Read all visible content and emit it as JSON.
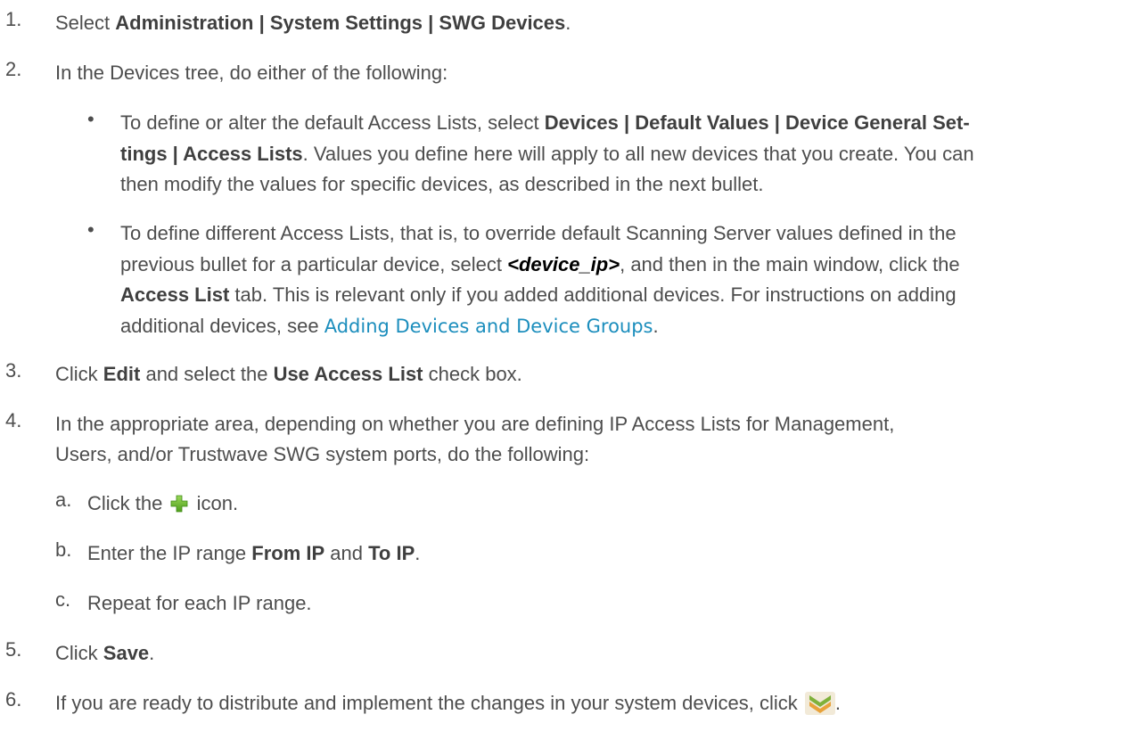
{
  "steps": [
    {
      "num": "1.",
      "pre": "Select ",
      "bold": "Administration | System Settings | SWG Devices",
      "post": "."
    },
    {
      "num": "2.",
      "text": "In the Devices tree, do either of the following:",
      "bullets": [
        {
          "mark": "•",
          "pre": "To define or alter the default Access Lists, select ",
          "bold_line1": "Devices | Default Values | Device General Set-",
          "bold_line2": "tings | Access Lists",
          "post_line2": ". Values you define here will apply to all new devices that you create. You can",
          "line3": "then modify the values for specific devices, as described in the next bullet."
        },
        {
          "mark": "•",
          "line1": "To define different Access Lists, that is, to override default Scanning Server values defined in the",
          "line2_pre": "previous bullet for a particular device, select ",
          "line2_bi": "<device_ip>",
          "line2_post": ", and then in the main window, click the",
          "line3_bold": "Access List",
          "line3_post": " tab. This is relevant only if you added additional devices. For instructions on adding",
          "line4_pre": "additional devices, see ",
          "line4_link": "Adding Devices and Device Groups",
          "line4_post": "."
        }
      ]
    },
    {
      "num": "3.",
      "pre": "Click ",
      "bold1": "Edit",
      "mid": " and select the ",
      "bold2": "Use Access List",
      "post": " check box."
    },
    {
      "num": "4.",
      "line1": "In the appropriate area, depending on whether you are defining IP Access Lists for Management,",
      "line2": "Users, and/or Trustwave SWG system ports, do the following:",
      "substeps": [
        {
          "mark": "a.",
          "pre": "Click the ",
          "icon": "add-plus-icon",
          "post": " icon."
        },
        {
          "mark": "b.",
          "pre": "Enter the IP range ",
          "bold1": "From IP",
          "mid": " and ",
          "bold2": "To IP",
          "post": "."
        },
        {
          "mark": "c.",
          "text": "Repeat for each IP range."
        }
      ]
    },
    {
      "num": "5.",
      "pre": "Click ",
      "bold": "Save",
      "post": "."
    },
    {
      "num": "6.",
      "pre": "If you are ready to distribute and implement the changes in your system devices, click ",
      "icon": "deploy-changes-icon",
      "post": "."
    }
  ],
  "colors": {
    "text": "#4d4d4d",
    "link": "#1c8ebd",
    "plus_icon": "#6fba2c",
    "deploy_icon": "#e8a23a"
  }
}
